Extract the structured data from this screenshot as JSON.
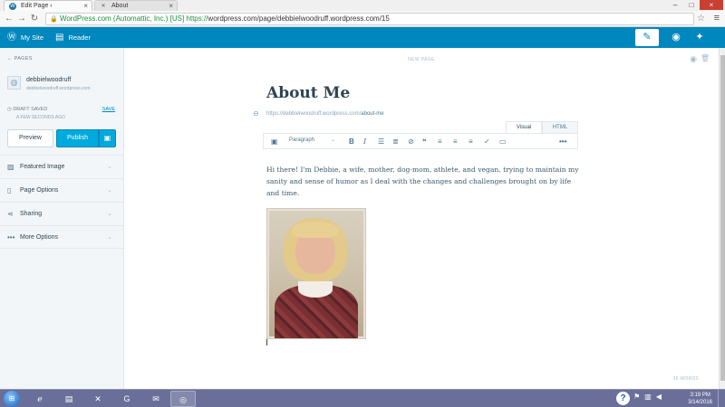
{
  "browser": {
    "tabs": [
      {
        "title": "Edit Page ‹ debbielwoodr",
        "close": "×"
      },
      {
        "title": "About",
        "close": "×"
      }
    ],
    "window_controls": {
      "minimize": "–",
      "maximize": "□",
      "close": "×"
    },
    "address_bar": {
      "ev_label": "WordPress.com (Automattic, Inc.) [US]",
      "url_scheme": "https://",
      "url_rest": "wordpress.com/page/debbielwoodruff.wordpress.com/15"
    }
  },
  "masterbar": {
    "my_site": "My Site",
    "reader": "Reader"
  },
  "sidebar": {
    "back_label": "PAGES",
    "site_name": "debbielwoodruff",
    "site_url": "debbielwoodruff.wordpress.com",
    "status_label": "DRAFT SAVED",
    "save_link": "SAVE",
    "status_time": "A FEW SECONDS AGO",
    "preview_button": "Preview",
    "publish_button": "Publish",
    "sections": [
      {
        "label": "Featured Image"
      },
      {
        "label": "Page Options"
      },
      {
        "label": "Sharing"
      },
      {
        "label": "More Options"
      }
    ]
  },
  "editor": {
    "header_label": "NEW PAGE",
    "title": "About Me",
    "permalink_base": "https://debbielwoodruff.wordpress.com/",
    "permalink_slug": "about-me",
    "mode_tabs": {
      "visual": "Visual",
      "html": "HTML"
    },
    "format_select": "Paragraph",
    "body": "Hi there!  I'm Debbie, a wife, mother, dog-mom, athlete, and vegan, trying to maintain my sanity and sense of humor as I deal with the changes and challenges brought on by life and time.",
    "word_count": "36 WORDS"
  },
  "taskbar": {
    "clock_time": "3:19 PM",
    "clock_date": "3/14/2016"
  },
  "colors": {
    "masterbar": "#0087be",
    "publish": "#00aadc",
    "taskbar": "#6a6f9a"
  }
}
